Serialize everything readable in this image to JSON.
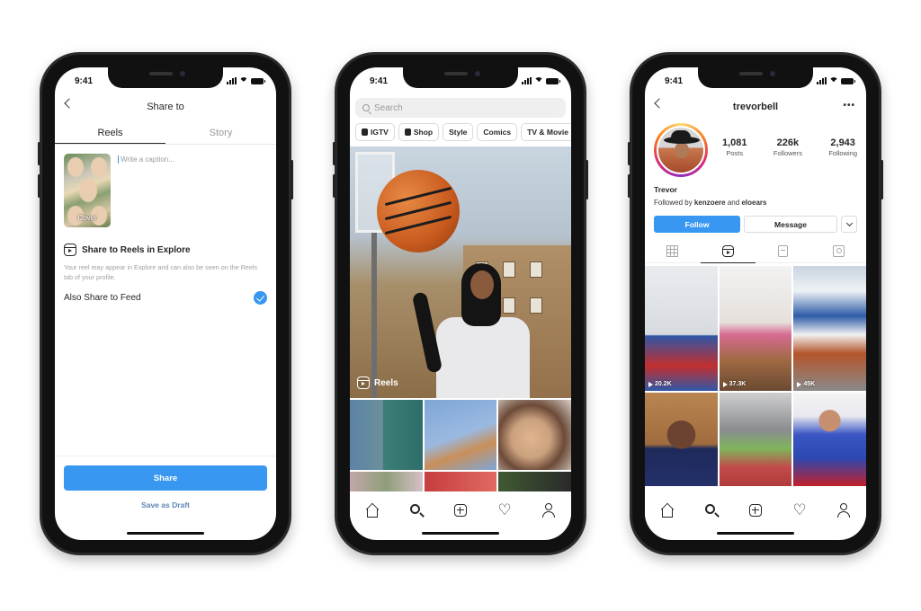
{
  "status_bar": {
    "time": "9:41"
  },
  "share_screen": {
    "title": "Share to",
    "tabs": [
      {
        "label": "Reels",
        "active": true
      },
      {
        "label": "Story",
        "active": false
      }
    ],
    "cover_label": "Cover",
    "caption_placeholder": "Write a caption...",
    "reels_explore": {
      "icon": "reels-icon",
      "title": "Share to Reels in Explore",
      "description": "Your reel may appear in Explore and can also be seen on the Reels tab of your profile."
    },
    "also_share_to_feed": {
      "label": "Also Share to Feed",
      "checked": true
    },
    "share_button": "Share",
    "save_draft_link": "Save as Draft",
    "accent_color": "#3897f0"
  },
  "explore_screen": {
    "search_placeholder": "Search",
    "chips": [
      {
        "label": "IGTV",
        "icon": "igtv-icon"
      },
      {
        "label": "Shop",
        "icon": "shop-bag-icon"
      },
      {
        "label": "Style",
        "icon": null
      },
      {
        "label": "Comics",
        "icon": null
      },
      {
        "label": "TV & Movie",
        "icon": null
      }
    ],
    "hero_label": "Reels",
    "grid_tiles": [
      "photo-couple",
      "photo-rainbow-hand",
      "photo-smiling-woman",
      "photo-flowers",
      "photo-red",
      "photo-portrait"
    ]
  },
  "profile_screen": {
    "username": "trevorbell",
    "stats": [
      {
        "value": "1,081",
        "label": "Posts"
      },
      {
        "value": "226k",
        "label": "Followers"
      },
      {
        "value": "2,943",
        "label": "Following"
      }
    ],
    "name": "Trevor",
    "followed_by_prefix": "Followed by",
    "followed_by_users": [
      "kenzoere",
      "eloears"
    ],
    "followed_by_joiner": "and",
    "follow_button": "Follow",
    "message_button": "Message",
    "profile_tabs": [
      "grid-icon",
      "reels-icon",
      "igtv-icon",
      "tagged-icon"
    ],
    "active_profile_tab": "reels-icon",
    "reels": [
      {
        "views": "20.2K"
      },
      {
        "views": "37.3K"
      },
      {
        "views": "45K"
      },
      {
        "views": ""
      },
      {
        "views": ""
      },
      {
        "views": ""
      }
    ]
  },
  "tab_bar": [
    "home-icon",
    "search-icon",
    "new-post-icon",
    "activity-heart-icon",
    "profile-icon"
  ]
}
